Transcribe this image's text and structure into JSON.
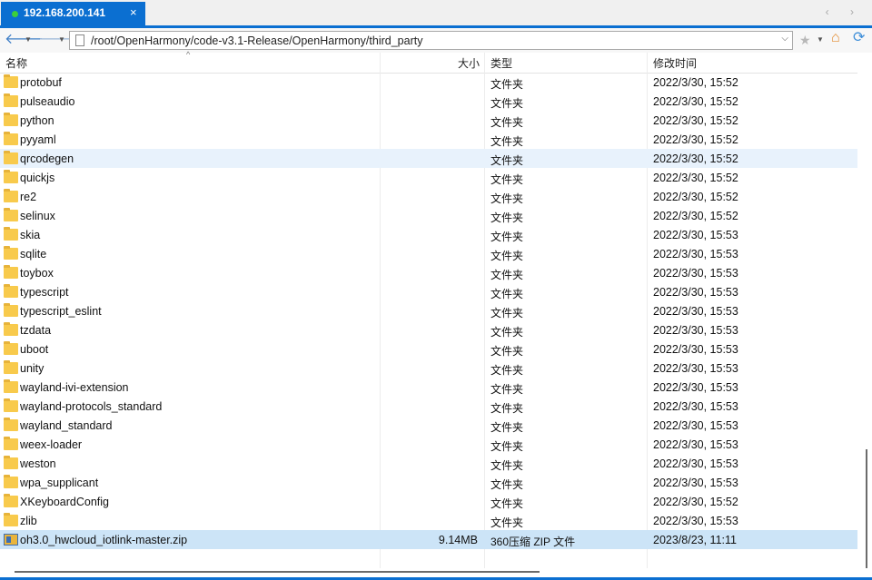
{
  "tab": {
    "title": "192.168.200.141",
    "close": "×",
    "scroll_arrows": "‹ ›"
  },
  "toolbar": {
    "back": "🡐",
    "forward": "🡒",
    "drop": "▼",
    "address": "/root/OpenHarmony/code-v3.1-Release/OpenHarmony/third_party",
    "address_chevron": "⌵",
    "star": "★",
    "star_drop": "▼",
    "home": "⌂",
    "refresh": "⟳"
  },
  "columns": {
    "name": "名称",
    "size": "大小",
    "type": "类型",
    "modified": "修改时间",
    "sort_indicator": "^"
  },
  "rows": [
    {
      "name": "protobuf",
      "size": "",
      "type": "文件夹",
      "modified": "2022/3/30, 15:52",
      "icon": "folder-icon"
    },
    {
      "name": "pulseaudio",
      "size": "",
      "type": "文件夹",
      "modified": "2022/3/30, 15:52",
      "icon": "folder-icon"
    },
    {
      "name": "python",
      "size": "",
      "type": "文件夹",
      "modified": "2022/3/30, 15:52",
      "icon": "folder-icon"
    },
    {
      "name": "pyyaml",
      "size": "",
      "type": "文件夹",
      "modified": "2022/3/30, 15:52",
      "icon": "folder-icon"
    },
    {
      "name": "qrcodegen",
      "size": "",
      "type": "文件夹",
      "modified": "2022/3/30, 15:52",
      "icon": "folder-icon"
    },
    {
      "name": "quickjs",
      "size": "",
      "type": "文件夹",
      "modified": "2022/3/30, 15:52",
      "icon": "folder-icon"
    },
    {
      "name": "re2",
      "size": "",
      "type": "文件夹",
      "modified": "2022/3/30, 15:52",
      "icon": "folder-icon"
    },
    {
      "name": "selinux",
      "size": "",
      "type": "文件夹",
      "modified": "2022/3/30, 15:52",
      "icon": "folder-icon"
    },
    {
      "name": "skia",
      "size": "",
      "type": "文件夹",
      "modified": "2022/3/30, 15:53",
      "icon": "folder-icon"
    },
    {
      "name": "sqlite",
      "size": "",
      "type": "文件夹",
      "modified": "2022/3/30, 15:53",
      "icon": "folder-icon"
    },
    {
      "name": "toybox",
      "size": "",
      "type": "文件夹",
      "modified": "2022/3/30, 15:53",
      "icon": "folder-icon"
    },
    {
      "name": "typescript",
      "size": "",
      "type": "文件夹",
      "modified": "2022/3/30, 15:53",
      "icon": "folder-icon"
    },
    {
      "name": "typescript_eslint",
      "size": "",
      "type": "文件夹",
      "modified": "2022/3/30, 15:53",
      "icon": "folder-icon"
    },
    {
      "name": "tzdata",
      "size": "",
      "type": "文件夹",
      "modified": "2022/3/30, 15:53",
      "icon": "folder-icon"
    },
    {
      "name": "uboot",
      "size": "",
      "type": "文件夹",
      "modified": "2022/3/30, 15:53",
      "icon": "folder-icon"
    },
    {
      "name": "unity",
      "size": "",
      "type": "文件夹",
      "modified": "2022/3/30, 15:53",
      "icon": "folder-icon"
    },
    {
      "name": "wayland-ivi-extension",
      "size": "",
      "type": "文件夹",
      "modified": "2022/3/30, 15:53",
      "icon": "folder-icon"
    },
    {
      "name": "wayland-protocols_standard",
      "size": "",
      "type": "文件夹",
      "modified": "2022/3/30, 15:53",
      "icon": "folder-icon"
    },
    {
      "name": "wayland_standard",
      "size": "",
      "type": "文件夹",
      "modified": "2022/3/30, 15:53",
      "icon": "folder-icon"
    },
    {
      "name": "weex-loader",
      "size": "",
      "type": "文件夹",
      "modified": "2022/3/30, 15:53",
      "icon": "folder-icon"
    },
    {
      "name": "weston",
      "size": "",
      "type": "文件夹",
      "modified": "2022/3/30, 15:53",
      "icon": "folder-icon"
    },
    {
      "name": "wpa_supplicant",
      "size": "",
      "type": "文件夹",
      "modified": "2022/3/30, 15:53",
      "icon": "folder-icon"
    },
    {
      "name": "XKeyboardConfig",
      "size": "",
      "type": "文件夹",
      "modified": "2022/3/30, 15:52",
      "icon": "folder-icon"
    },
    {
      "name": "zlib",
      "size": "",
      "type": "文件夹",
      "modified": "2022/3/30, 15:53",
      "icon": "folder-icon"
    },
    {
      "name": "oh3.0_hwcloud_iotlink-master.zip",
      "size": "9.14MB",
      "type": "360压缩 ZIP 文件",
      "modified": "2023/8/23, 11:11",
      "icon": "zip-file-icon"
    }
  ],
  "hovered_row": 4,
  "selected_row": 24,
  "colors": {
    "accent": "#0b6fd1",
    "hover": "#e8f2fc",
    "selected": "#cce4f7",
    "folder": "#f8ca4c"
  }
}
